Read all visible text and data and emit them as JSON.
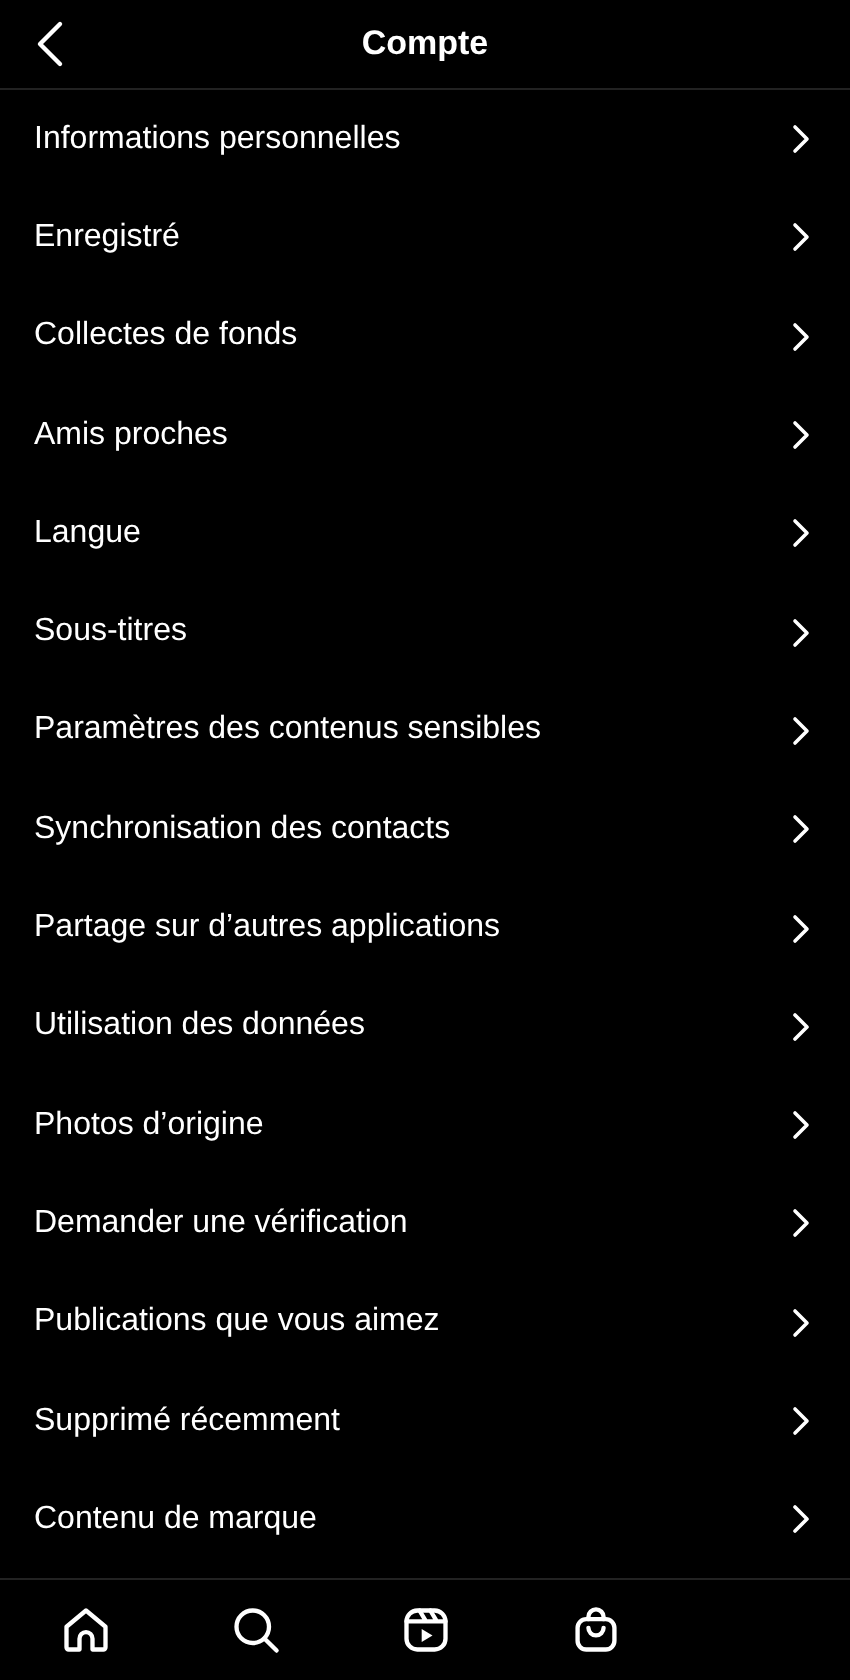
{
  "header": {
    "title": "Compte"
  },
  "items": [
    {
      "label": "Informations personnelles"
    },
    {
      "label": "Enregistré"
    },
    {
      "label": "Collectes de fonds"
    },
    {
      "label": "Amis proches"
    },
    {
      "label": "Langue"
    },
    {
      "label": "Sous-titres"
    },
    {
      "label": "Paramètres des contenus sensibles"
    },
    {
      "label": "Synchronisation des contacts"
    },
    {
      "label": "Partage sur d’autres applications"
    },
    {
      "label": "Utilisation des données"
    },
    {
      "label": "Photos d’origine"
    },
    {
      "label": "Demander une vérification"
    },
    {
      "label": "Publications que vous aimez"
    },
    {
      "label": "Supprimé récemment"
    },
    {
      "label": "Contenu de marque"
    }
  ],
  "nav": [
    {
      "kind": "home"
    },
    {
      "kind": "search"
    },
    {
      "kind": "reels"
    },
    {
      "kind": "shop"
    }
  ]
}
